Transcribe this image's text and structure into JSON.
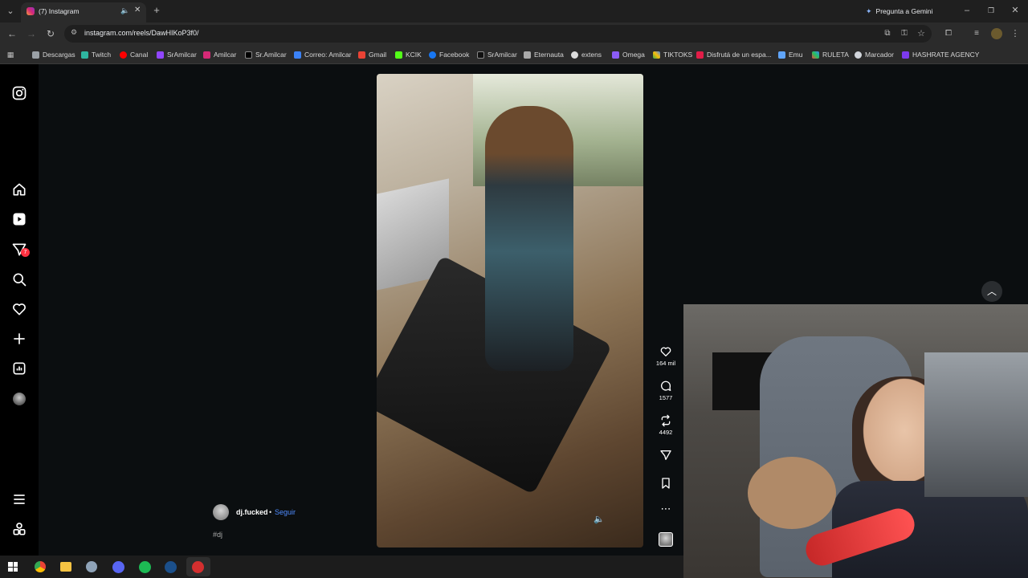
{
  "browser": {
    "tab_title": "(7) Instagram",
    "url": "instagram.com/reels/DawHIKoP3f0/",
    "gemini_label": "Pregunta a Gemini",
    "bookmarks": [
      "Descargas",
      "Twitch",
      "Canal",
      "SrAmilcar",
      "Amilcar",
      "Sr.Amilcar",
      "Correo: Amilcar",
      "Gmail",
      "KCIK",
      "Facebook",
      "SrAmilcar",
      "Eternauta",
      "extens",
      "Omega",
      "TIKTOKS",
      "Disfrutá de un espa...",
      "Emu",
      "RULETA",
      "Marcador",
      "HASHRATE AGENCY"
    ]
  },
  "nav": {
    "notification_count": "7"
  },
  "reel": {
    "username": "dj.fucked",
    "separator": "•",
    "follow_label": "Seguir",
    "caption": "#dj",
    "likes": "164 mil",
    "comments": "1577",
    "reposts": "4492"
  },
  "colors": {
    "accent": "#4f8cff",
    "badge": "#ff3040"
  }
}
